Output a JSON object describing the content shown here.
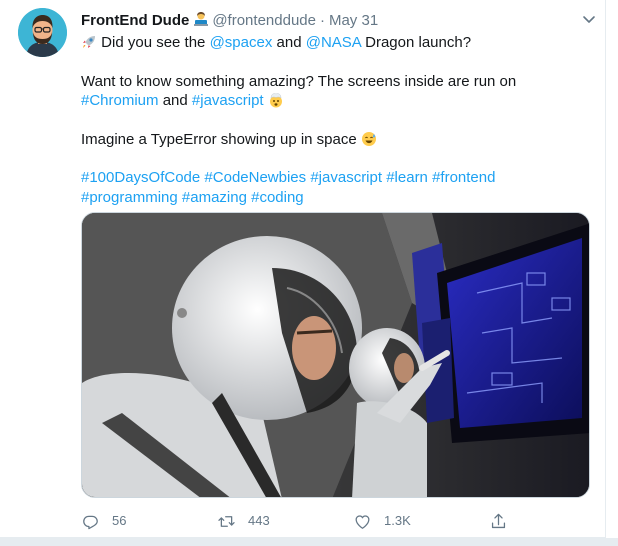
{
  "tweet": {
    "author_name": "FrontEnd Dude",
    "author_handle": "@frontenddude",
    "separator": "·",
    "date": "May 31",
    "line1_pre": "Did you see the",
    "mention_spacex": "@spacex",
    "line1_and": "and",
    "mention_nasa": "@NASA",
    "line1_post": "Dragon launch?",
    "line2_pre": "Want to know something amazing? The screens inside are run on",
    "hashtag_chromium": "#Chromium",
    "line2_and": "and",
    "hashtag_javascript": "#javascript",
    "line3": "Imagine a TypeError showing up in space",
    "hashtags": [
      "#100DaysOfCode",
      "#CodeNewbies",
      "#javascript",
      "#learn",
      "#frontend",
      "#programming",
      "#amazing",
      "#coding"
    ]
  },
  "actions": {
    "reply_count": "56",
    "retweet_count": "443",
    "like_count": "1.3K"
  },
  "icons": {
    "verified_badge": "technologist-emoji-icon",
    "rocket": "rocket-emoji-icon",
    "exploding_head": "exploding-head-emoji-icon",
    "sweat_smile": "sweat-smile-emoji-icon",
    "caret": "chevron-down-icon",
    "reply": "reply-icon",
    "retweet": "retweet-icon",
    "like": "heart-icon",
    "share": "share-icon"
  },
  "colors": {
    "link": "#1da1f2",
    "muted": "#657786",
    "text": "#14171a",
    "border": "#e6ecf0"
  }
}
